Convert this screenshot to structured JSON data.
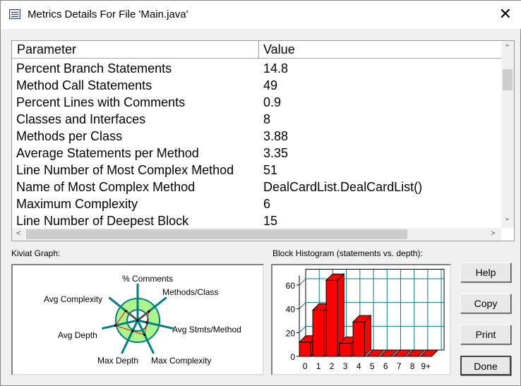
{
  "window": {
    "title": "Metrics Details For File 'Main.java'",
    "close": "✕"
  },
  "table": {
    "headers": [
      "Parameter",
      "Value"
    ],
    "rows": [
      [
        "Percent Branch Statements",
        "14.8"
      ],
      [
        "Method Call Statements",
        "49"
      ],
      [
        "Percent Lines with Comments",
        "0.9"
      ],
      [
        "Classes and Interfaces",
        "8"
      ],
      [
        "Methods per Class",
        "3.88"
      ],
      [
        "Average Statements per Method",
        "3.35"
      ],
      [
        "Line Number of Most Complex Method",
        "51"
      ],
      [
        "Name of Most Complex Method",
        "DealCardList.DealCardList()"
      ],
      [
        "Maximum Complexity",
        "6"
      ],
      [
        "Line Number of Deepest Block",
        "15"
      ]
    ]
  },
  "kiviat": {
    "label": "Kiviat Graph:",
    "axes": [
      "% Comments",
      "Methods/Class",
      "Avg Stmts/Method",
      "Max Complexity",
      "Max Depth",
      "Avg Depth",
      "Avg Complexity"
    ],
    "values": [
      0.0,
      0.85,
      0.55,
      0.95,
      0.7,
      1.35,
      0.9
    ],
    "ring_color": "#adf58a",
    "axis_color": "#008080",
    "line_color": "#ff0000"
  },
  "chart_data": {
    "type": "bar",
    "title": "Block Histogram (statements vs. depth):",
    "categories": [
      "0",
      "1",
      "2",
      "3",
      "4",
      "5",
      "6",
      "7",
      "8",
      "9+"
    ],
    "values": [
      12,
      39,
      64,
      11,
      29,
      0,
      0,
      0,
      0,
      0
    ],
    "yticks": [
      "0",
      "20",
      "40",
      "60"
    ],
    "ylim": [
      0,
      68
    ],
    "bar_color": "#ff0000",
    "grid_color": "#008080"
  },
  "buttons": {
    "help": "Help",
    "copy": "Copy",
    "print": "Print",
    "done": "Done"
  }
}
